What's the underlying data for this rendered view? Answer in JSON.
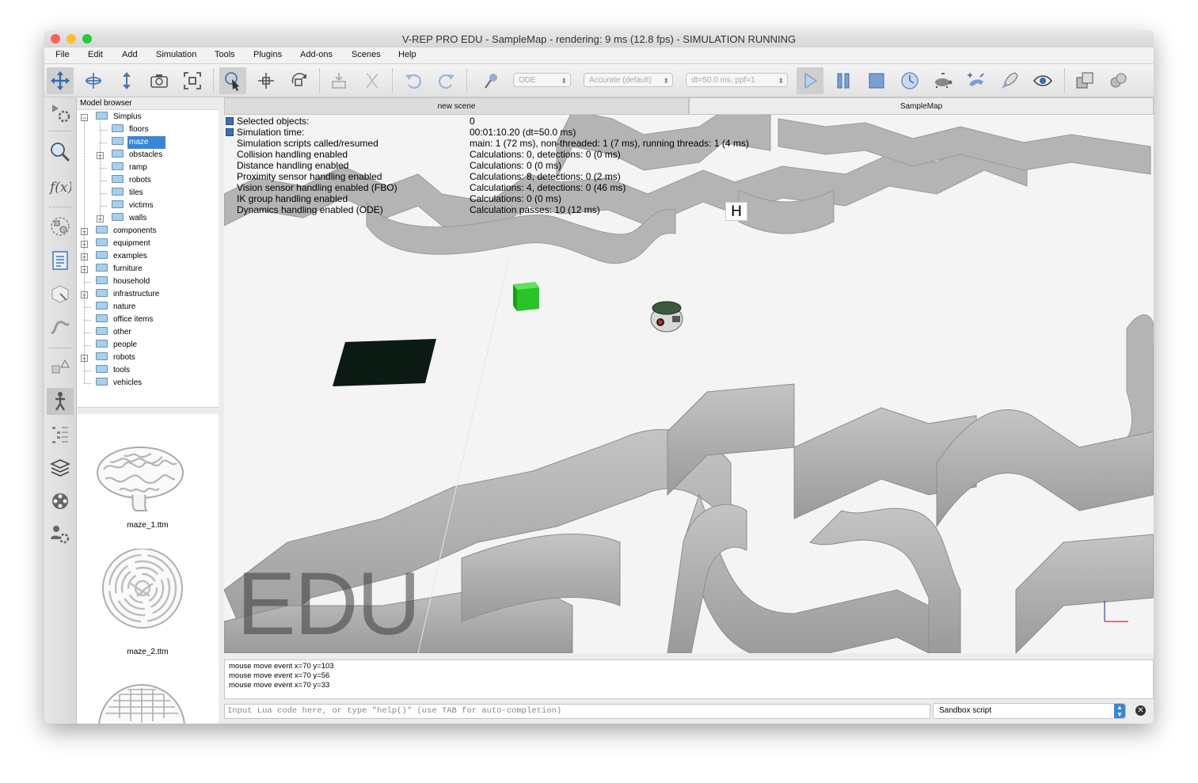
{
  "window": {
    "title": "V-REP PRO EDU - SampleMap - rendering: 9 ms (12.8 fps) - SIMULATION RUNNING"
  },
  "menu": [
    "File",
    "Edit",
    "Add",
    "Simulation",
    "Tools",
    "Plugins",
    "Add-ons",
    "Scenes",
    "Help"
  ],
  "toolbar": {
    "engine": "ODE",
    "accuracy": "Accurate (default)",
    "timestep": "dt=50.0 ms, ppf=1",
    "icons": [
      "camera-pan-icon",
      "camera-rotate-icon",
      "camera-shift-icon",
      "camera-angle-icon",
      "fit-to-view-icon",
      "click-select-icon",
      "object-shift-icon",
      "object-rotate-icon",
      "assemble-icon",
      "transfer-dna-icon",
      "undo-icon",
      "redo-icon",
      "dynamics-toggle-icon",
      "start-simulation-icon",
      "pause-simulation-icon",
      "stop-simulation-icon",
      "real-time-icon",
      "slow-down-icon",
      "speed-up-icon",
      "thread-rendering-icon",
      "visualization-icon",
      "page-selector-icon",
      "scene-selector-icon"
    ]
  },
  "left_toolbar_icons": [
    "simulation-settings-icon",
    "selection-icon",
    "calculation-modules-icon",
    "collections-icon",
    "scripts-icon",
    "shape-edit-icon",
    "path-edit-icon",
    "user-settings-icon",
    "model-browser-icon",
    "scene-hierarchy-icon",
    "layers-icon",
    "video-recorder-icon",
    "user-prefs-icon"
  ],
  "model_browser": {
    "title": "Model browser",
    "tree": [
      {
        "label": "Simplus",
        "level": 0,
        "expander": "−"
      },
      {
        "label": "floors",
        "level": 1,
        "expander": ""
      },
      {
        "label": "maze",
        "level": 1,
        "expander": "",
        "selected": true
      },
      {
        "label": "obstacles",
        "level": 1,
        "expander": "+"
      },
      {
        "label": "ramp",
        "level": 1,
        "expander": ""
      },
      {
        "label": "robots",
        "level": 1,
        "expander": ""
      },
      {
        "label": "tiles",
        "level": 1,
        "expander": ""
      },
      {
        "label": "victims",
        "level": 1,
        "expander": ""
      },
      {
        "label": "walls",
        "level": 1,
        "expander": "+"
      },
      {
        "label": "components",
        "level": 0,
        "expander": "+"
      },
      {
        "label": "equipment",
        "level": 0,
        "expander": "+"
      },
      {
        "label": "examples",
        "level": 0,
        "expander": "+"
      },
      {
        "label": "furniture",
        "level": 0,
        "expander": "+"
      },
      {
        "label": "household",
        "level": 0,
        "expander": ""
      },
      {
        "label": "infrastructure",
        "level": 0,
        "expander": "+"
      },
      {
        "label": "nature",
        "level": 0,
        "expander": ""
      },
      {
        "label": "office items",
        "level": 0,
        "expander": ""
      },
      {
        "label": "other",
        "level": 0,
        "expander": ""
      },
      {
        "label": "people",
        "level": 0,
        "expander": ""
      },
      {
        "label": "robots",
        "level": 0,
        "expander": "+"
      },
      {
        "label": "tools",
        "level": 0,
        "expander": ""
      },
      {
        "label": "vehicles",
        "level": 0,
        "expander": ""
      }
    ],
    "thumbnails": [
      "maze_1.ttm",
      "maze_2.ttm"
    ]
  },
  "scene_tabs": [
    {
      "label": "new scene",
      "active": false
    },
    {
      "label": "SampleMap",
      "active": true
    }
  ],
  "info_panel": {
    "rows": [
      {
        "label": "Selected objects:",
        "value": "0"
      },
      {
        "label": "Simulation time:",
        "value": "00:01:10.20 (dt=50.0 ms)"
      },
      {
        "label": "Simulation scripts called/resumed",
        "value": "main: 1 (72 ms), non-threaded: 1 (7 ms), running threads: 1 (4 ms)"
      },
      {
        "label": "Collision handling enabled",
        "value": "Calculations: 0, detections: 0 (0 ms)"
      },
      {
        "label": "Distance handling enabled",
        "value": "Calculations: 0 (0 ms)"
      },
      {
        "label": "Proximity sensor handling enabled",
        "value": "Calculations: 8, detections: 0 (2 ms)"
      },
      {
        "label": "Vision sensor handling enabled (FBO)",
        "value": "Calculations: 4, detections: 0 (46 ms)"
      },
      {
        "label": "IK group handling enabled",
        "value": "Calculations: 0 (0 ms)"
      },
      {
        "label": "Dynamics handling enabled (ODE)",
        "value": "Calculation passes: 10 (12 ms)"
      }
    ]
  },
  "scene": {
    "watermark": "EDU",
    "marker": "H"
  },
  "console": {
    "lines": [
      "mouse move event x=70 y=103",
      "mouse move event x=70 y=56",
      "mouse move event x=70 y=33"
    ]
  },
  "command_line": {
    "placeholder": "Input Lua code here, or type \"help()\" (use TAB for auto-completion)",
    "script_selector": "Sandbox script"
  },
  "colors": {
    "selection": "#3a86d6",
    "wall": "#a8a8a8",
    "floor": "#f4f4f4",
    "cube": "#22bb22"
  }
}
